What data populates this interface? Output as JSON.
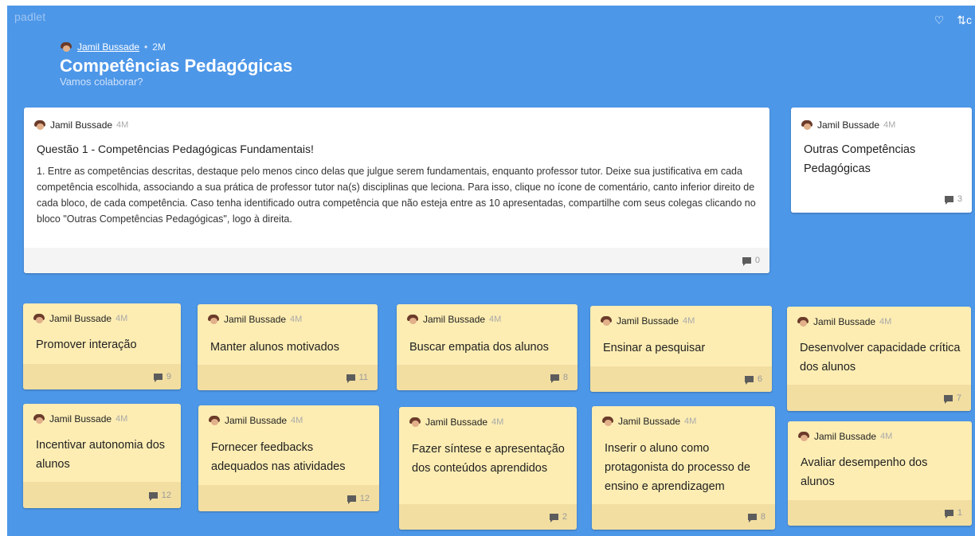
{
  "app": {
    "brand": "padlet"
  },
  "topbar": {
    "heart_icon": "heart-icon",
    "remake_icon": "remake-icon"
  },
  "header": {
    "author": "Jamil Bussade",
    "time": "2M",
    "title": "Competências Pedagógicas",
    "subtitle": "Vamos colaborar?"
  },
  "cards": [
    {
      "author": "Jamil Bussade",
      "time": "4M",
      "title": "Questão 1 - Competências Pedagógicas Fundamentais!",
      "body": "1. Entre as competências descritas, destaque pelo menos cinco delas que julgue serem fundamentais, enquanto professor tutor. Deixe sua justificativa em cada competência escolhida, associando  a sua prática de professor tutor na(s) disciplinas que leciona. Para isso, clique no ícone de comentário, canto inferior direito de cada bloco, de cada competência. Caso tenha identificado outra competência que não esteja entre as 10 apresentadas, compartilhe com seus colegas clicando no bloco \"Outras Competências Pedagógicas\", logo à direita.",
      "comments": "0"
    },
    {
      "author": "Jamil Bussade",
      "time": "4M",
      "title": "Outras Competências Pedagógicas",
      "comments": "3"
    },
    {
      "author": "Jamil Bussade",
      "time": "4M",
      "title": "Promover interação",
      "comments": "9"
    },
    {
      "author": "Jamil Bussade",
      "time": "4M",
      "title": "Manter alunos motivados",
      "comments": "11"
    },
    {
      "author": "Jamil Bussade",
      "time": "4M",
      "title": "Buscar empatia dos alunos",
      "comments": "8"
    },
    {
      "author": "Jamil Bussade",
      "time": "4M",
      "title": "Ensinar a pesquisar",
      "comments": "6"
    },
    {
      "author": "Jamil Bussade",
      "time": "4M",
      "title": "Desenvolver capacidade crítica dos alunos",
      "comments": "7"
    },
    {
      "author": "Jamil Bussade",
      "time": "4M",
      "title": "Incentivar autonomia dos alunos",
      "comments": "12"
    },
    {
      "author": "Jamil Bussade",
      "time": "4M",
      "title": "Fornecer feedbacks adequados nas atividades",
      "comments": "12"
    },
    {
      "author": "Jamil Bussade",
      "time": "4M",
      "title": "Fazer síntese e apresentação dos conteúdos aprendidos",
      "comments": "2"
    },
    {
      "author": "Jamil Bussade",
      "time": "4M",
      "title": "Inserir o aluno como protagonista do processo de ensino e aprendizagem",
      "comments": "8"
    },
    {
      "author": "Jamil Bussade",
      "time": "4M",
      "title": "Avaliar desempenho dos alunos",
      "comments": "1"
    }
  ],
  "colors": {
    "board": "#4d97e8",
    "card_white": "#ffffff",
    "card_yellow": "#fdedb3",
    "footer_yellow": "#f2dea1"
  }
}
